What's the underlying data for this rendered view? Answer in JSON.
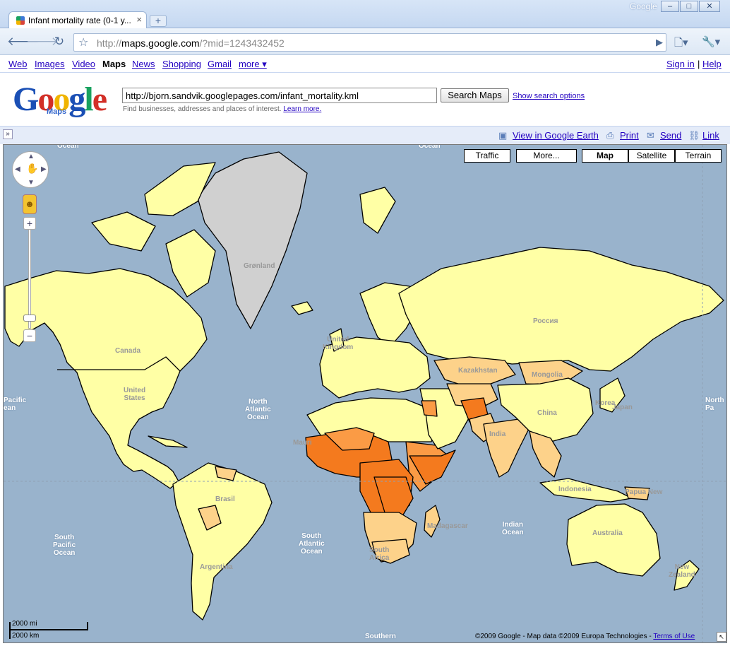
{
  "window": {
    "brand": "Google",
    "tab_title": "Infant mortality rate (0-1 y...",
    "url_prefix": "http://",
    "url_host": "maps.google.com",
    "url_path": "/?mid=1243432452"
  },
  "gbar": {
    "items": [
      "Web",
      "Images",
      "Video",
      "Maps",
      "News",
      "Shopping",
      "Gmail",
      "more ▾"
    ],
    "sign_in": "Sign in",
    "sep": "|",
    "help": "Help"
  },
  "search": {
    "logo_sub": "Maps",
    "query": "http://bjorn.sandvik.googlepages.com/infant_mortality.kml",
    "button": "Search Maps",
    "options": "Show search options",
    "hint": "Find businesses, addresses and places of interest.",
    "hint_link": "Learn more."
  },
  "actions": {
    "view_earth": "View in Google Earth",
    "print": "Print",
    "send": "Send",
    "link": "Link"
  },
  "map": {
    "types": [
      "Traffic",
      "More...",
      "Map",
      "Satellite",
      "Terrain"
    ],
    "labels": {
      "ocean_tl": "Ocean",
      "ocean_tr": "Ocean",
      "canada": "Canada",
      "us": "United\nStates",
      "n_atlantic": "North\nAtlantic\nOcean",
      "pacific_l": "Pacific\nean",
      "n_pacific_r": "North\nPa",
      "brazil": "Brasil",
      "s_pacific": "South\nPacific\nOcean",
      "s_atlantic": "South\nAtlantic\nOcean",
      "indian": "Indian\nOcean",
      "southern": "Southern",
      "russia": "Россия",
      "china": "China",
      "india": "India",
      "kazakhstan": "Kazakhstan",
      "mongolia": "Mongolia",
      "australia": "Australia",
      "indonesia": "Indonesia",
      "new_zealand": "New\nZealand",
      "argentina": "Argentina",
      "madagascar": "Madagascar",
      "japan": "Japan",
      "korea": "Korea",
      "greenland": "Grønland",
      "uk": "United\nKingdom",
      "png": "Papua New",
      "mauritania": "Mauri",
      "south_africa": "South\nAfrica"
    },
    "scale_mi": "2000 mi",
    "scale_km": "2000 km",
    "copyright": "©2009 Google - Map data ©2009 Europa Technologies - ",
    "terms": "Terms of Use"
  },
  "colors": {
    "ocean": "#99b3cc",
    "low": "#ffffa5",
    "mid": "#fdd28a",
    "high": "#fb9b45",
    "very_high": "#f47a1e",
    "no_data": "#d0d0d0"
  }
}
